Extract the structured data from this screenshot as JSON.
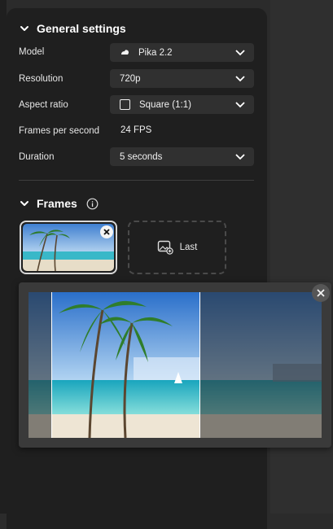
{
  "general": {
    "title": "General settings",
    "model": {
      "label": "Model",
      "value": "Pika 2.2"
    },
    "resolution": {
      "label": "Resolution",
      "value": "720p"
    },
    "aspect": {
      "label": "Aspect ratio",
      "value": "Square (1:1)"
    },
    "fps": {
      "label": "Frames per second",
      "value": "24 FPS"
    },
    "duration": {
      "label": "Duration",
      "value": "5 seconds"
    }
  },
  "frames": {
    "title": "Frames",
    "last_label": "Last"
  },
  "icons": [
    "chevron-down-icon",
    "info-icon",
    "close-icon",
    "add-image-icon",
    "aspect-square-icon",
    "pika-logo-icon"
  ],
  "colors": {
    "panel": "#1f1f1f",
    "field": "#303030",
    "popover": "#3a3a3a"
  }
}
